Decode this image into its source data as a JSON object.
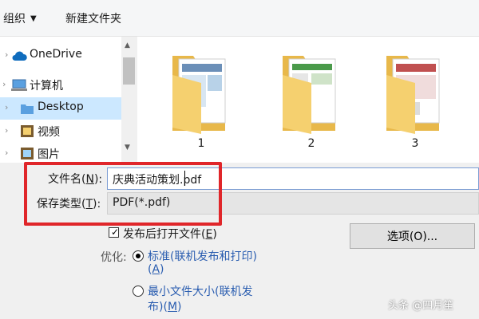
{
  "toolbar": {
    "organize_label": "组织",
    "new_folder_label": "新建文件夹"
  },
  "nav": {
    "items": [
      {
        "label": "OneDrive",
        "icon": "cloud-icon"
      },
      {
        "label": "计算机",
        "icon": "computer-icon"
      },
      {
        "label": "Desktop",
        "icon": "folder-icon",
        "selected": true
      },
      {
        "label": "视频",
        "icon": "video-folder-icon"
      },
      {
        "label": "图片",
        "icon": "picture-folder-icon"
      }
    ]
  },
  "files": [
    {
      "name": "1"
    },
    {
      "name": "2"
    },
    {
      "name": "3"
    }
  ],
  "form": {
    "filename_label": "文件名(",
    "filename_key": "N",
    "filename_label_end": "):",
    "filename_value": "庆典活动策划.pdf",
    "savetype_label": "保存类型(",
    "savetype_key": "T",
    "savetype_label_end": "):",
    "savetype_value": "PDF(*.pdf)"
  },
  "options": {
    "open_after_publish": "发布后打开文件(",
    "open_after_publish_key": "E",
    "open_after_publish_end": ")",
    "open_after_publish_checked": true,
    "optimize_label": "优化:",
    "standard_line1": "标准(联机发布和打印)",
    "standard_line2_pre": "(",
    "standard_key": "A",
    "standard_line2_end": ")",
    "min_line1": "最小文件大小(联机发",
    "min_line2_pre": "布)(",
    "min_key": "M",
    "min_line2_end": ")",
    "options_button": "选项(O)..."
  },
  "watermark": "头条 @四月笙",
  "colors": {
    "highlight": "#e0262a",
    "selected_nav": "#cce8ff",
    "onedrive": "#0f6cbd",
    "folder": "#f5d06f"
  }
}
